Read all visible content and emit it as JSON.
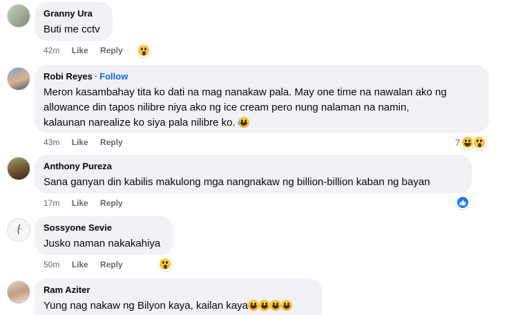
{
  "comments": [
    {
      "author": "Granny Ura",
      "follow": "",
      "text": [
        "Buti me cctv"
      ],
      "time": "42m",
      "like": "Like",
      "reply": "Reply",
      "reaction_icon": "wow-reaction-icon",
      "reaction_count": ""
    },
    {
      "author": "Robi Reyes",
      "follow": "Follow",
      "text": [
        "Meron kasambahay tita ko dati na mag nanakaw pala. May one time na nawalan ako ng",
        "allowance din tapos nilibre niya ako ng ice cream pero nung nalaman na namin,",
        "kalaunan narealize ko siya pala nilibre ko."
      ],
      "time": "43m",
      "like": "Like",
      "reply": "Reply",
      "reaction_icon": "haha-wow-reaction-icons",
      "reaction_count": "7"
    },
    {
      "author": "Anthony Pureza",
      "follow": "",
      "text": [
        "Sana ganyan din kabilis makulong mga nangnakaw ng billion-billion kaban ng bayan"
      ],
      "time": "17m",
      "like": "Like",
      "reply": "Reply",
      "reaction_icon": "like-reaction-icon",
      "reaction_count": ""
    },
    {
      "author": "Sossyone Sevie",
      "follow": "",
      "text": [
        "Jusko naman nakakahiya"
      ],
      "time": "50m",
      "like": "Like",
      "reply": "Reply",
      "reaction_icon": "wow-reaction-icon",
      "reaction_count": ""
    },
    {
      "author": "Ram Aziter",
      "follow": "",
      "text": [
        "Yung nag nakaw ng Bilyon kaya, kailan kaya"
      ],
      "time": "",
      "like": "",
      "reply": "",
      "reaction_icon": "",
      "reaction_count": ""
    }
  ],
  "colors": {
    "bubble": "#f0f2f5",
    "link": "#0866ff",
    "meta": "#65676b",
    "like_badge": "#1877f2"
  }
}
